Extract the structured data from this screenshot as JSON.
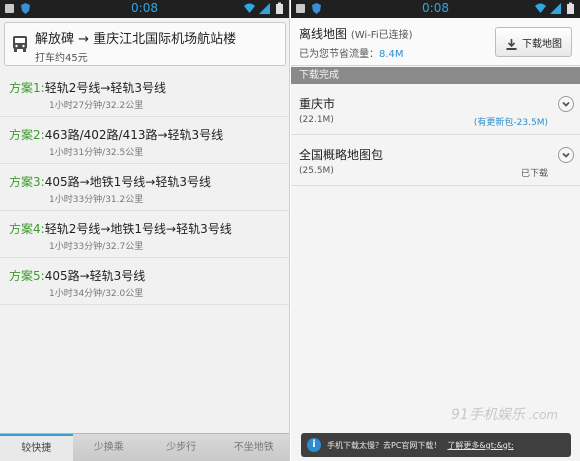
{
  "left": {
    "status_time": "0:08",
    "route": {
      "title": "解放碑 → 重庆江北国际机场航站楼",
      "taxi": "打车约45元"
    },
    "plans": [
      {
        "label": "方案1:",
        "route": "轻轨2号线→轻轨3号线",
        "meta": "1小时27分钟/32.2公里"
      },
      {
        "label": "方案2:",
        "route": "463路/402路/413路→轻轨3号线",
        "meta": "1小时31分钟/32.5公里"
      },
      {
        "label": "方案3:",
        "route": "405路→地铁1号线→轻轨3号线",
        "meta": "1小时33分钟/31.2公里"
      },
      {
        "label": "方案4:",
        "route": "轻轨2号线→地铁1号线→轻轨3号线",
        "meta": "1小时33分钟/32.7公里"
      },
      {
        "label": "方案5:",
        "route": "405路→轻轨3号线",
        "meta": "1小时34分钟/32.0公里"
      }
    ],
    "tabs": [
      "较快捷",
      "少换乘",
      "少步行",
      "不坐地铁"
    ]
  },
  "right": {
    "status_time": "0:08",
    "header": {
      "title": "离线地图",
      "wifi": "(Wi-Fi已连接)",
      "saved_prefix": "已为您节省流量：",
      "saved_value": "8.4M",
      "download_button": "下载地图"
    },
    "section_title": "下载完成",
    "maps": [
      {
        "name": "重庆市",
        "size": "(22.1M)",
        "status": "(有更新包-23.5M)"
      },
      {
        "name": "全国概略地图包",
        "size": "(25.5M)",
        "status": "已下载"
      }
    ],
    "watermark": "91手机娱乐",
    "watermark_sub": ".com",
    "toast": {
      "text": "手机下载太慢？去PC官网下载！",
      "link": "了解更多&gt;&gt;"
    }
  },
  "colors": {
    "accent_blue": "#2fa6e0",
    "plan_green": "#3c9a2a",
    "update_blue": "#2a8fcf"
  }
}
